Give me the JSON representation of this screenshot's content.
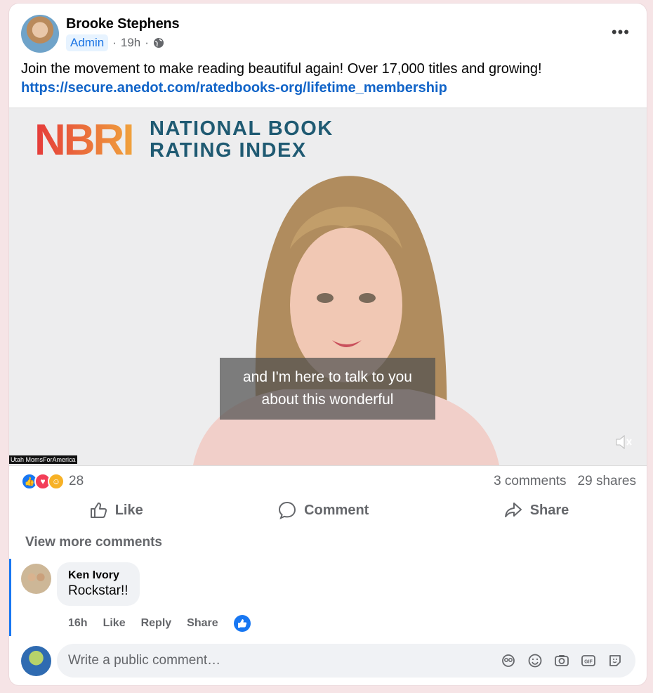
{
  "post": {
    "author": "Brooke Stephens",
    "badge": "Admin",
    "time": "19h",
    "caption_text": "Join the movement to make reading beautiful again! Over 17,000 titles and growing! ",
    "caption_link": "https://secure.anedot.com/ratedbooks-org/lifetime_membership"
  },
  "video": {
    "logo_abbr": "NBRI",
    "logo_line1": "NATIONAL BOOK",
    "logo_line2": "RATING INDEX",
    "subtitle_line1": "and I'm here to talk to you",
    "subtitle_line2": "about this wonderful",
    "watermark": "Utah MomsForAmerica"
  },
  "stats": {
    "reactions_count": "28",
    "comments": "3 comments",
    "shares": "29 shares"
  },
  "actions": {
    "like": "Like",
    "comment": "Comment",
    "share": "Share"
  },
  "comments": {
    "view_more": "View more comments",
    "items": [
      {
        "name": "Ken Ivory",
        "text": "Rockstar!!",
        "time": "16h",
        "like": "Like",
        "reply": "Reply",
        "share": "Share"
      }
    ],
    "input_placeholder": "Write a public comment…"
  },
  "colors": {
    "accent": "#1877f2",
    "link": "#1164c8",
    "meta": "#65676b"
  }
}
